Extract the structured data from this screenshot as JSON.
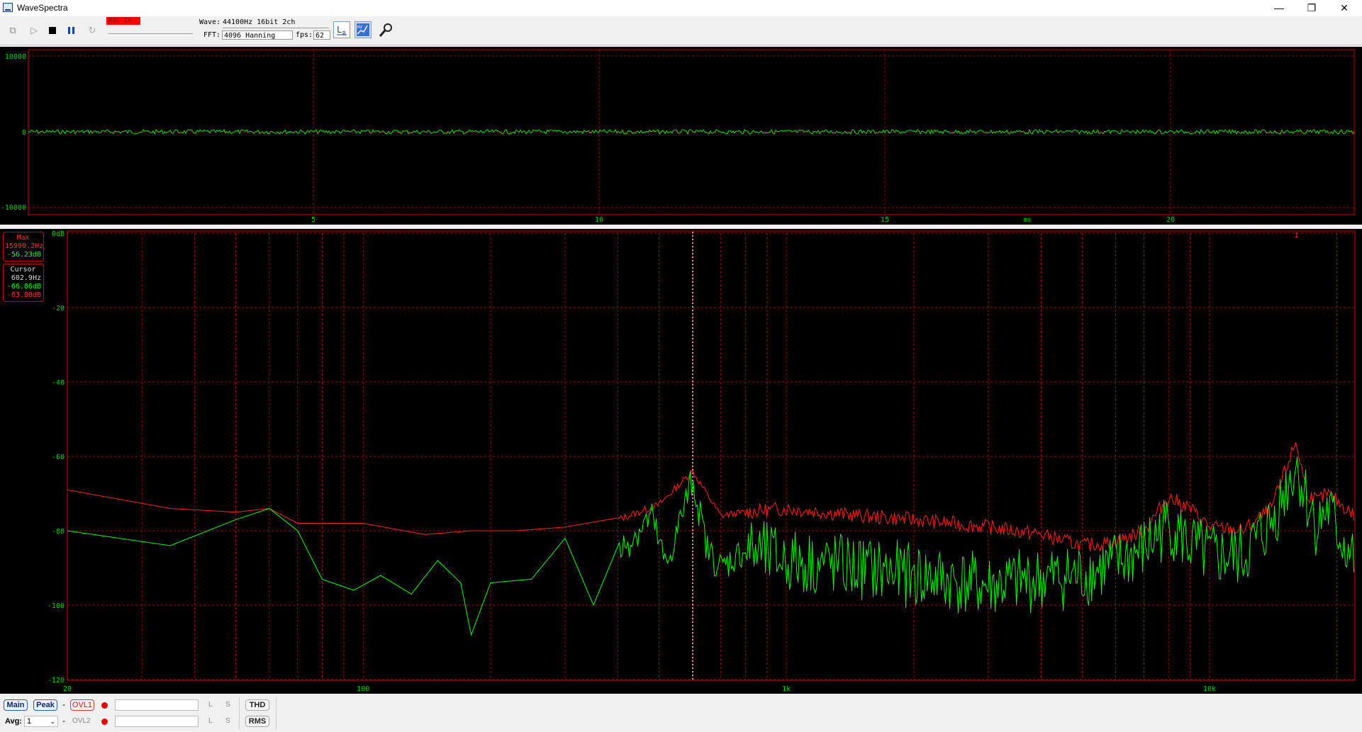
{
  "window": {
    "title": "WaveSpectra",
    "controls": {
      "minimize": "—",
      "restore": "❐",
      "close": "✕"
    }
  },
  "toolbar": {
    "rec_label": "Rec In",
    "wave_label": "Wave:",
    "wave_value": "44100Hz 16bit 2ch",
    "fft_label": "FFT:",
    "fft_value": "4096 Hanning",
    "fps_label": "fps:",
    "fps_value": "62",
    "icons": [
      "copy-icon",
      "play-icon",
      "stop-icon",
      "pause-icon",
      "refresh-icon",
      "channel-lr-icon",
      "spectrum-settings-icon",
      "wrench-icon"
    ]
  },
  "waveform": {
    "y_ticks": [
      "10000",
      "0",
      "-10000"
    ],
    "x_ticks": [
      "5",
      "10",
      "15",
      "20"
    ],
    "x_unit": "ms"
  },
  "spectrum": {
    "max_label": "Max",
    "max_freq": "15999.2Hz",
    "max_db": "-56.23dB",
    "cursor_label": "Cursor",
    "cursor_freq": "602.9Hz",
    "cursor_db_green": "-66.86dB",
    "cursor_db_red": "-63.80dB",
    "top_marker": "I"
  },
  "chart_data": {
    "type": "line",
    "x_scale": "log",
    "xlim": [
      20,
      22050
    ],
    "ylim": [
      -120,
      0
    ],
    "x_tick_labels": [
      "20",
      "100",
      "1k",
      "10k"
    ],
    "y_tick_labels": [
      "0dB",
      "-20",
      "-40",
      "-60",
      "-80",
      "-100",
      "-120"
    ],
    "colors": {
      "green": "#00ff00",
      "red": "#ff2020",
      "grid": "#c00000"
    },
    "series": [
      {
        "points": [
          [
            20,
            -80
          ],
          [
            35,
            -84
          ],
          [
            50,
            -77
          ],
          [
            60,
            -74
          ],
          [
            70,
            -80
          ],
          [
            80,
            -93
          ],
          [
            95,
            -96
          ],
          [
            110,
            -92
          ],
          [
            130,
            -97
          ],
          [
            150,
            -88
          ],
          [
            170,
            -94
          ],
          [
            180,
            -108
          ],
          [
            200,
            -94
          ],
          [
            250,
            -93
          ],
          [
            300,
            -82
          ],
          [
            350,
            -100
          ],
          [
            400,
            -86
          ],
          [
            480,
            -76
          ],
          [
            520,
            -90
          ],
          [
            600,
            -66
          ],
          [
            650,
            -85
          ],
          [
            700,
            -90
          ],
          [
            800,
            -85
          ],
          [
            1000,
            -88
          ],
          [
            1500,
            -90
          ],
          [
            2000,
            -92
          ],
          [
            3000,
            -95
          ],
          [
            4000,
            -93
          ],
          [
            5000,
            -92
          ],
          [
            6000,
            -89
          ],
          [
            7000,
            -85
          ],
          [
            8000,
            -78
          ],
          [
            9000,
            -84
          ],
          [
            10000,
            -87
          ],
          [
            12000,
            -87
          ],
          [
            14000,
            -78
          ],
          [
            16000,
            -62
          ],
          [
            17000,
            -72
          ],
          [
            18000,
            -79
          ],
          [
            19000,
            -74
          ],
          [
            20000,
            -80
          ],
          [
            22050,
            -88
          ]
        ]
      },
      {
        "points": [
          [
            20,
            -69
          ],
          [
            35,
            -74
          ],
          [
            50,
            -75
          ],
          [
            60,
            -74
          ],
          [
            70,
            -78
          ],
          [
            100,
            -78
          ],
          [
            140,
            -81
          ],
          [
            180,
            -80
          ],
          [
            230,
            -80
          ],
          [
            300,
            -79
          ],
          [
            400,
            -77
          ],
          [
            500,
            -73
          ],
          [
            600,
            -64
          ],
          [
            700,
            -76
          ],
          [
            800,
            -75
          ],
          [
            1000,
            -74
          ],
          [
            1500,
            -76
          ],
          [
            2000,
            -77
          ],
          [
            3000,
            -79
          ],
          [
            4000,
            -81
          ],
          [
            5000,
            -84
          ],
          [
            6000,
            -83
          ],
          [
            7000,
            -80
          ],
          [
            8000,
            -71
          ],
          [
            9000,
            -74
          ],
          [
            10000,
            -79
          ],
          [
            12000,
            -80
          ],
          [
            14000,
            -74
          ],
          [
            16000,
            -56
          ],
          [
            17000,
            -70
          ],
          [
            18000,
            -72
          ],
          [
            19000,
            -70
          ],
          [
            20000,
            -72
          ],
          [
            22050,
            -76
          ]
        ]
      }
    ]
  },
  "bottombar": {
    "main": "Main",
    "peak": "Peak",
    "ovl1": "OVL1",
    "ovl2": "OVL2",
    "dash": "-",
    "avg_label": "Avg:",
    "avg_value": "1",
    "L": "L",
    "S": "S",
    "thd": "THD",
    "rms": "RMS"
  }
}
